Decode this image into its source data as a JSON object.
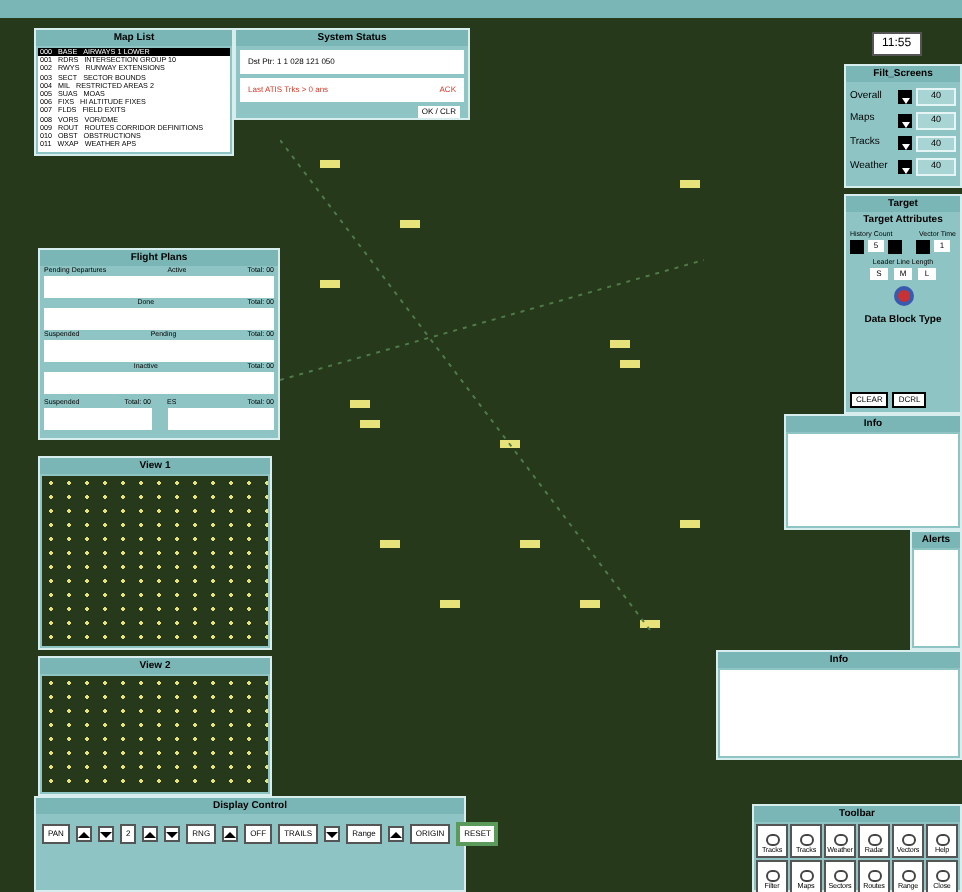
{
  "map_list": {
    "title": "Map List",
    "rows": [
      {
        "number": "000",
        "code": "BASE",
        "name": "AIRWAYS 1 LOWER",
        "selected": true
      },
      {
        "number": "001",
        "code": "RDRS",
        "name": "INTERSECTION GROUP 10",
        "selected": false
      },
      {
        "number": "002",
        "code": "RWYS",
        "name": "RUNWAY EXTENSIONS",
        "selected": false
      },
      {
        "number": "003",
        "code": "SECT",
        "name": "SECTOR BOUNDS",
        "selected": false
      },
      {
        "number": "004",
        "code": "MIL",
        "name": "RESTRICTED AREAS 2",
        "selected": false
      },
      {
        "number": "005",
        "code": "SUAS",
        "name": "MOAS",
        "selected": false
      },
      {
        "number": "006",
        "code": "FIXS",
        "name": "HI ALTITUDE FIXES",
        "selected": false
      },
      {
        "number": "007",
        "code": "FLDS",
        "name": "FIELD EXITS",
        "selected": false
      },
      {
        "number": "008",
        "code": "VORS",
        "name": "VOR/DME",
        "selected": false
      },
      {
        "number": "009",
        "code": "ROUT",
        "name": "ROUTES CORRIDOR DEFINITIONS",
        "selected": false
      },
      {
        "number": "010",
        "code": "OBST",
        "name": "OBSTRUCTIONS",
        "selected": false
      },
      {
        "number": "011",
        "code": "WXAP",
        "name": "WEATHER APS",
        "selected": false
      }
    ]
  },
  "system_status": {
    "title": "System Status",
    "line": "Dst Ptr: 1 1 028 121 050",
    "alert": "Last ATIS Trks > 0 ans",
    "ack": "ACK",
    "footer": "OK / CLR"
  },
  "top_right": {
    "time": "11:55"
  },
  "filter_panel": {
    "title": "Filt_Screens",
    "rows": [
      {
        "label": "Overall",
        "value": "40"
      },
      {
        "label": "Maps",
        "value": "40"
      },
      {
        "label": "Tracks",
        "value": "40"
      },
      {
        "label": "Weather",
        "value": "40"
      }
    ]
  },
  "target_panel": {
    "title": "Target",
    "subtitle": "Target Attributes",
    "history_label": "History Count",
    "history_value": "5",
    "vector_label": "Vector Time",
    "vector_value": "1",
    "leader_label": "Leader Line Length",
    "leader_buttons": [
      "S",
      "M",
      "L"
    ],
    "data_block_title": "Data Block Type",
    "actions": [
      "CLEAR",
      "DCRL"
    ]
  },
  "flight_plans": {
    "title": "Flight Plans",
    "sections": [
      {
        "heading": "Active",
        "count": "Total: 00"
      },
      {
        "heading": "Done",
        "count": "Total: 00"
      },
      {
        "heading": "Pending",
        "count": "Total: 00"
      },
      {
        "heading": "Inactive",
        "count": "Total: 00"
      }
    ],
    "left_headings": [
      "Pending Departures",
      "Suspended"
    ],
    "bottom": [
      {
        "heading": "Suspended",
        "count": "Total: 00"
      },
      {
        "heading": "ES",
        "count": "Total: 00"
      }
    ]
  },
  "views": [
    {
      "title": "View 1"
    },
    {
      "title": "View 2"
    }
  ],
  "popups": [
    {
      "title": "Info"
    },
    {
      "title": "Alerts"
    },
    {
      "title": "Info"
    }
  ],
  "display_control": {
    "title": "Display Control",
    "items": [
      {
        "kind": "field",
        "value": "PAN"
      },
      {
        "kind": "up"
      },
      {
        "kind": "down"
      },
      {
        "kind": "field",
        "value": "2"
      },
      {
        "kind": "up"
      },
      {
        "kind": "down"
      },
      {
        "kind": "field",
        "value": "RNG"
      },
      {
        "kind": "up"
      },
      {
        "kind": "field",
        "value": "OFF"
      },
      {
        "kind": "field",
        "value": "TRAILS"
      },
      {
        "kind": "down"
      },
      {
        "kind": "field",
        "value": "Range"
      },
      {
        "kind": "up"
      },
      {
        "kind": "field",
        "value": "ORIGIN"
      }
    ],
    "reset": "RESET"
  },
  "toolbar": {
    "title": "Toolbar",
    "buttons": [
      "Tracks",
      "Tracks",
      "Weather",
      "Radar",
      "Vectors",
      "Help",
      "Filter",
      "Maps",
      "Sectors",
      "Routes",
      "Range",
      "Close"
    ]
  }
}
